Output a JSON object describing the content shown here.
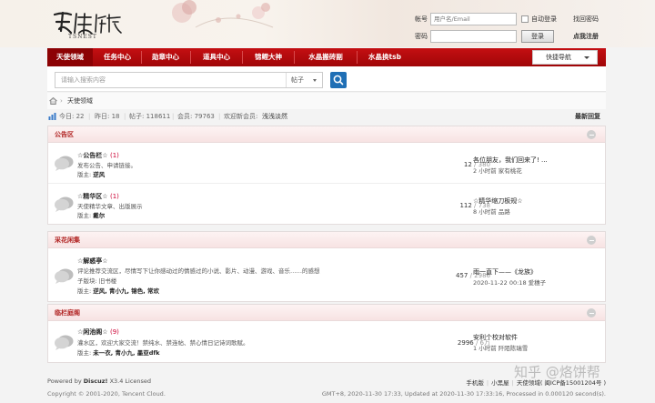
{
  "header": {
    "logo_sub": "TSNEST",
    "login": {
      "account_label": "帐号",
      "account_placeholder": "用户名/Email",
      "password_label": "密码",
      "auto_login": "自动登录",
      "find_password": "找回密码",
      "login_button": "登录",
      "register": "点我注册"
    }
  },
  "nav": {
    "items": [
      "天使领域",
      "任务中心",
      "勋章中心",
      "道具中心",
      "锦鲤大神",
      "水晶搬砖副",
      "水晶换tsb"
    ],
    "quick_nav": "快捷导航"
  },
  "search": {
    "placeholder": "请输入搜索内容",
    "scope": "帖子"
  },
  "breadcrumb": {
    "separator": "›",
    "current": "天使领域"
  },
  "stats": {
    "today": "今日: 22",
    "yesterday": "昨日: 18",
    "posts": "帖子: 118611",
    "members": "会员: 79763",
    "welcome_prefix": "欢迎新会员:",
    "newest_member": "浅浅淡然",
    "latest_reply": "最新回复"
  },
  "sections": [
    {
      "title": "公告区",
      "forums": [
        {
          "name": "☆公告栏☆",
          "count": "(1)",
          "desc": "发布公告、申请链接。",
          "mod_label": "版主:",
          "mods": "逆风",
          "threads": "12",
          "posts": " / 380",
          "last_title": "各位朋友，我们回来了!   ...",
          "last_meta": "2 小时前 家有桃花"
        },
        {
          "name": "☆精华区☆",
          "count": "(1)",
          "desc": "天使精华文章、出版展示",
          "mod_label": "版主:",
          "mods": "戴尔",
          "threads": "112",
          "posts": " / 738",
          "last_title": "☆精华缩刀板规☆",
          "last_meta": "8 小时前 品路"
        }
      ]
    },
    {
      "title": "采花闲集",
      "forums": [
        {
          "name": "☆解惑亭☆",
          "count": "",
          "desc": "评论推荐交流区，尽情写下让你感动过的情感过的小说、影片、动漫、游戏、音乐……的感想",
          "sub": "子版块: 旧书楼",
          "mod_label": "版主:",
          "mods": "逆风, 青小九, 锦色, 常欢",
          "threads": "457",
          "posts": " / 2986",
          "last_title": "雨一直下——《龙族》",
          "last_meta": "2020-11-22 00:18 爱穗子"
        }
      ]
    },
    {
      "title": "临栏庭阁",
      "forums": [
        {
          "name": "☆闲池阁☆",
          "count": "(9)",
          "desc": "灌水区，欢迎大家交流！禁纯水、禁连帖、禁心情日记诗词歌赋。",
          "mod_label": "版主:",
          "mods": "未一衣, 青小九, 墨亚dfk",
          "threads": "2996",
          "posts": " / 6万",
          "last_title": "安利个校对软件",
          "last_meta": "1 小时前 阡陌陈瑞雪"
        }
      ]
    }
  ],
  "footer": {
    "powered_prefix": "Powered by",
    "powered_name": "Discuz!",
    "powered_suffix": " X3.4 Licensed",
    "copyright": "Copyright © 2001-2020, Tencent Cloud.",
    "links": [
      "手机版",
      "小黑屋",
      "天使领域( 闽ICP备15001204号 )"
    ],
    "gmt": "GMT+8, 2020-11-30 17:33, Updated at 2020-11-30 17:33:16, Processed in 0.000120 second(s)."
  },
  "watermark": "知乎 @烙饼帮",
  "colors": {
    "nav_red": "#c40f12",
    "search_blue": "#1f6fb5",
    "section_title": "#b0201f"
  }
}
